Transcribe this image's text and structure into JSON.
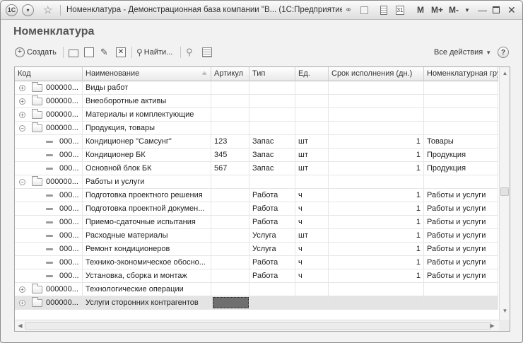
{
  "window": {
    "app_icon": "1С",
    "title": "Номенклатура - Демонстрационная база компании \"В... (1С:Предприятие)",
    "controls": [
      "M",
      "M+",
      "M-"
    ]
  },
  "page": {
    "title": "Номенклатура"
  },
  "toolbar": {
    "create_label": "Создать",
    "find_label": "Найти...",
    "all_actions_label": "Все действия",
    "help_label": "?"
  },
  "table": {
    "columns": [
      "Код",
      "Наименование",
      "Артикул",
      "Тип",
      "Ед.",
      "Срок исполнения (дн.)",
      "Номенклатурная группа"
    ],
    "rows": [
      {
        "level": 0,
        "kind": "group",
        "expanded": false,
        "code": "000000...",
        "name": "Виды работ",
        "article": "",
        "type": "",
        "unit": "",
        "term": "",
        "group": ""
      },
      {
        "level": 0,
        "kind": "group",
        "expanded": false,
        "code": "000000...",
        "name": "Внеоборотные активы",
        "article": "",
        "type": "",
        "unit": "",
        "term": "",
        "group": ""
      },
      {
        "level": 0,
        "kind": "group",
        "expanded": false,
        "code": "000000...",
        "name": "Материалы и комплектующие",
        "article": "",
        "type": "",
        "unit": "",
        "term": "",
        "group": ""
      },
      {
        "level": 0,
        "kind": "group",
        "expanded": true,
        "code": "000000...",
        "name": "Продукция, товары",
        "article": "",
        "type": "",
        "unit": "",
        "term": "",
        "group": ""
      },
      {
        "level": 1,
        "kind": "item",
        "code": "000...",
        "name": "Кондиционер \"Самсунг\"",
        "article": "123",
        "type": "Запас",
        "unit": "шт",
        "term": "1",
        "group": "Товары"
      },
      {
        "level": 1,
        "kind": "item",
        "code": "000...",
        "name": "Кондиционер БК",
        "article": "345",
        "type": "Запас",
        "unit": "шт",
        "term": "1",
        "group": "Продукция"
      },
      {
        "level": 1,
        "kind": "item",
        "code": "000...",
        "name": "Основной блок БК",
        "article": "567",
        "type": "Запас",
        "unit": "шт",
        "term": "1",
        "group": "Продукция"
      },
      {
        "level": 0,
        "kind": "group",
        "expanded": true,
        "code": "000000...",
        "name": "Работы и услуги",
        "article": "",
        "type": "",
        "unit": "",
        "term": "",
        "group": ""
      },
      {
        "level": 1,
        "kind": "item",
        "code": "000...",
        "name": "Подготовка проектного решения",
        "article": "",
        "type": "Работа",
        "unit": "ч",
        "term": "1",
        "group": "Работы и услуги"
      },
      {
        "level": 1,
        "kind": "item",
        "code": "000...",
        "name": "Подготовка проектной докумен...",
        "article": "",
        "type": "Работа",
        "unit": "ч",
        "term": "1",
        "group": "Работы и услуги"
      },
      {
        "level": 1,
        "kind": "item",
        "code": "000...",
        "name": "Приемо-сдаточные испытания",
        "article": "",
        "type": "Работа",
        "unit": "ч",
        "term": "1",
        "group": "Работы и услуги"
      },
      {
        "level": 1,
        "kind": "item",
        "code": "000...",
        "name": "Расходные материалы",
        "article": "",
        "type": "Услуга",
        "unit": "шт",
        "term": "1",
        "group": "Работы и услуги"
      },
      {
        "level": 1,
        "kind": "item",
        "code": "000...",
        "name": "Ремонт кондиционеров",
        "article": "",
        "type": "Услуга",
        "unit": "ч",
        "term": "1",
        "group": "Работы и услуги"
      },
      {
        "level": 1,
        "kind": "item",
        "code": "000...",
        "name": "Технико-экономическое обосно...",
        "article": "",
        "type": "Работа",
        "unit": "ч",
        "term": "1",
        "group": "Работы и услуги"
      },
      {
        "level": 1,
        "kind": "item",
        "code": "000...",
        "name": "Установка, сборка и монтаж",
        "article": "",
        "type": "Работа",
        "unit": "ч",
        "term": "1",
        "group": "Работы и услуги"
      },
      {
        "level": 0,
        "kind": "group",
        "expanded": false,
        "code": "000000...",
        "name": "Технологические операции",
        "article": "",
        "type": "",
        "unit": "",
        "term": "",
        "group": ""
      },
      {
        "level": 0,
        "kind": "group",
        "expanded": false,
        "selected": true,
        "code": "000000...",
        "name": "Услуги сторонних контрагентов",
        "article": "",
        "type": "",
        "unit": "",
        "term": "",
        "group": ""
      }
    ]
  }
}
